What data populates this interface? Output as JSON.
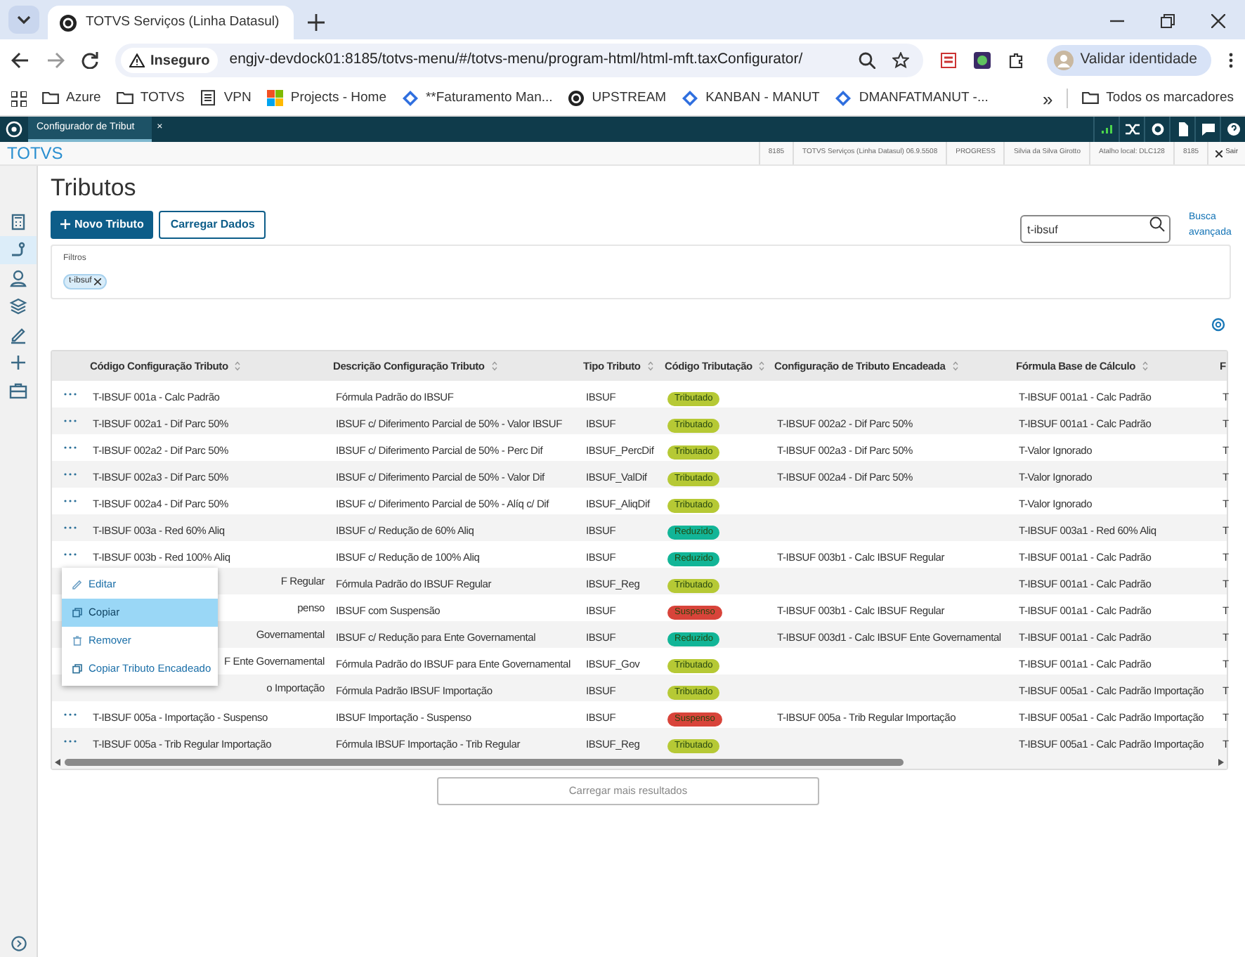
{
  "browser": {
    "tab_title": "TOTVS Serviços (Linha Datasul)",
    "security": "Inseguro",
    "url": "engjv-devdock01:8185/totvs-menu/#/totvs-menu/program-html/html-mft.taxConfigurator/",
    "profile": "Validar identidade",
    "bookmarks": [
      {
        "label": "Azure",
        "kind": "folder"
      },
      {
        "label": "TOTVS",
        "kind": "folder"
      },
      {
        "label": "VPN",
        "kind": "page"
      },
      {
        "label": "Projects - Home",
        "kind": "tiles"
      },
      {
        "label": "**Faturamento Man...",
        "kind": "diamond"
      },
      {
        "label": "UPSTREAM",
        "kind": "logo"
      },
      {
        "label": "KANBAN - MANUT",
        "kind": "diamond"
      },
      {
        "label": "DMANFATMANUT -...",
        "kind": "diamond"
      }
    ],
    "bookmarks_more": "»",
    "all_bookmarks": "Todos os marcadores"
  },
  "app_bar": {
    "tab": "Configurador de Tribut",
    "tab_close": "×"
  },
  "header": {
    "logo": "TOTVS",
    "info": [
      "8185",
      "TOTVS Serviços (Linha Datasul) 06.9.5508",
      "PROGRESS",
      "Silvia da Silva Girotto",
      "Atalho local: DLC128",
      "8185"
    ],
    "exit": "Sair"
  },
  "sidebar": {
    "items": [
      {
        "kind": "calculator",
        "selected": false
      },
      {
        "kind": "route",
        "selected": true
      },
      {
        "kind": "person",
        "selected": false
      },
      {
        "kind": "layers",
        "selected": false
      },
      {
        "kind": "pencil",
        "selected": false
      },
      {
        "kind": "plus",
        "selected": false
      },
      {
        "kind": "briefcase",
        "selected": false
      }
    ]
  },
  "page": {
    "title": "Tributos",
    "buttons": [
      {
        "label": "Novo Tributo",
        "kind": "primary"
      },
      {
        "label": "Carregar Dados",
        "kind": "secondary"
      }
    ],
    "search": {
      "value": "t-ibsuf"
    },
    "advanced_search": "Busca avançada",
    "filters": {
      "label": "Filtros",
      "chips": [
        "t-ibsuf"
      ]
    }
  },
  "table": {
    "columns": [
      "Código Configuração Tributo",
      "Descrição Configuração Tributo",
      "Tipo Tributo",
      "Código Tributação",
      "Configuração de Tributo Encadeada",
      "Fórmula Base de Cálculo",
      "F"
    ],
    "rows": [
      {
        "covered": false,
        "code": "T-IBSUF 001a - Calc Padrão",
        "description": "Fórmula Padrão do IBSUF",
        "type": "IBSUF",
        "status": {
          "label": "Tributado",
          "color": "#b6c935"
        },
        "chained": "",
        "formula": "T-IBSUF 001a1 - Calc Padrão",
        "column_7": "T"
      },
      {
        "covered": false,
        "code": "T-IBSUF 002a1 - Dif Parc 50%",
        "description": "IBSUF c/ Diferimento Parcial de 50% - Valor IBSUF",
        "type": "IBSUF",
        "status": {
          "label": "Tributado",
          "color": "#b6c935"
        },
        "chained": "T-IBSUF 002a2 - Dif Parc 50%",
        "formula": "T-IBSUF 001a1 - Calc Padrão",
        "column_7": "T"
      },
      {
        "covered": false,
        "code": "T-IBSUF 002a2 - Dif Parc 50%",
        "description": "IBSUF c/ Diferimento Parcial de 50% - Perc Dif",
        "type": "IBSUF_PercDif",
        "status": {
          "label": "Tributado",
          "color": "#b6c935"
        },
        "chained": "T-IBSUF 002a3 - Dif Parc 50%",
        "formula": "T-Valor Ignorado",
        "column_7": "T"
      },
      {
        "covered": false,
        "code": "T-IBSUF 002a3 - Dif Parc 50%",
        "description": "IBSUF c/ Diferimento Parcial de 50% - Valor Dif",
        "type": "IBSUF_ValDif",
        "status": {
          "label": "Tributado",
          "color": "#b6c935"
        },
        "chained": "T-IBSUF 002a4 - Dif Parc 50%",
        "formula": "T-Valor Ignorado",
        "column_7": "T"
      },
      {
        "covered": false,
        "code": "T-IBSUF 002a4 - Dif Parc 50%",
        "description": "IBSUF c/ Diferimento Parcial de 50% - Alíq c/ Dif",
        "type": "IBSUF_AliqDif",
        "status": {
          "label": "Tributado",
          "color": "#b6c935"
        },
        "chained": "",
        "formula": "T-Valor Ignorado",
        "column_7": "T"
      },
      {
        "covered": false,
        "code": "T-IBSUF 003a - Red 60% Aliq",
        "description": "IBSUF c/ Redução de 60% Aliq",
        "type": "IBSUF",
        "status": {
          "label": "Reduzido",
          "color": "#12b597"
        },
        "chained": "",
        "formula": "T-IBSUF 003a1 - Red 60% Aliq",
        "column_7": "T"
      },
      {
        "covered": false,
        "code": "T-IBSUF 003b - Red 100% Aliq",
        "description": "IBSUF c/ Redução de 100% Aliq",
        "type": "IBSUF",
        "status": {
          "label": "Reduzido",
          "color": "#12b597"
        },
        "chained": "T-IBSUF 003b1 - Calc IBSUF Regular",
        "formula": "T-IBSUF 001a1 - Calc Padrão",
        "column_7": "T"
      },
      {
        "covered": true,
        "code": "F Regular",
        "description": "Fórmula Padrão do IBSUF Regular",
        "type": "IBSUF_Reg",
        "status": {
          "label": "Tributado",
          "color": "#b6c935"
        },
        "chained": "",
        "formula": "T-IBSUF 001a1 - Calc Padrão",
        "column_7": "T"
      },
      {
        "covered": true,
        "code": "penso",
        "description": "IBSUF com Suspensão",
        "type": "IBSUF",
        "status": {
          "label": "Suspenso",
          "color": "#d8443a"
        },
        "chained": "T-IBSUF 003b1 - Calc IBSUF Regular",
        "formula": "T-IBSUF 001a1 - Calc Padrão",
        "column_7": "T"
      },
      {
        "covered": true,
        "code": "Governamental",
        "description": "IBSUF c/ Redução para Ente Governamental",
        "type": "IBSUF",
        "status": {
          "label": "Reduzido",
          "color": "#12b597"
        },
        "chained": "T-IBSUF 003d1 - Calc IBSUF Ente Governamental",
        "formula": "T-IBSUF 001a1 - Calc Padrão",
        "column_7": "T"
      },
      {
        "covered": true,
        "code": "F Ente Governamental",
        "description": "Fórmula Padrão do IBSUF para Ente Governamental",
        "type": "IBSUF_Gov",
        "status": {
          "label": "Tributado",
          "color": "#b6c935"
        },
        "chained": "",
        "formula": "T-IBSUF 001a1 - Calc Padrão",
        "column_7": "T"
      },
      {
        "covered": true,
        "code": "o Importação",
        "description": "Fórmula Padrão IBSUF Importação",
        "type": "IBSUF",
        "status": {
          "label": "Tributado",
          "color": "#b6c935"
        },
        "chained": "",
        "formula": "T-IBSUF 005a1 - Calc Padrão Importação",
        "column_7": "T"
      },
      {
        "covered": false,
        "code": "T-IBSUF 005a - Importação - Suspenso",
        "description": "IBSUF Importação - Suspenso",
        "type": "IBSUF",
        "status": {
          "label": "Suspenso",
          "color": "#d8443a"
        },
        "chained": "T-IBSUF 005a - Trib Regular Importação",
        "formula": "T-IBSUF 005a1 - Calc Padrão Importação",
        "column_7": "T"
      },
      {
        "covered": false,
        "code": "T-IBSUF 005a - Trib Regular Importação",
        "description": "Fórmula IBSUF Importação - Trib Regular",
        "type": "IBSUF_Reg",
        "status": {
          "label": "Tributado",
          "color": "#b6c935"
        },
        "chained": "",
        "formula": "T-IBSUF 005a1 - Calc Padrão Importação",
        "column_7": "T"
      }
    ]
  },
  "context_menu": {
    "items": [
      {
        "label": "Editar",
        "kind": "edit",
        "selected": false
      },
      {
        "label": "Copiar",
        "kind": "copy",
        "selected": true
      },
      {
        "label": "Remover",
        "kind": "remove",
        "selected": false
      },
      {
        "label": "Copiar Tributo Encadeado",
        "kind": "copy",
        "selected": false
      }
    ]
  },
  "load_more": "Carregar mais resultados"
}
